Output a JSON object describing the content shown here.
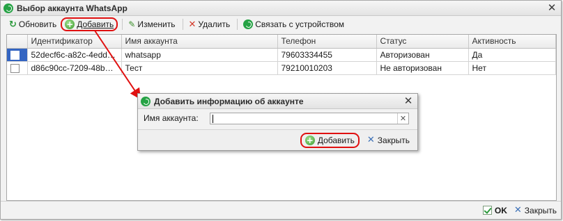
{
  "window": {
    "title": "Выбор аккаунта WhatsApp",
    "close_glyph": "✕"
  },
  "toolbar": {
    "refresh_label": "Обновить",
    "add_label": "Добавить",
    "edit_label": "Изменить",
    "delete_label": "Удалить",
    "connect_label": "Связать с устройством"
  },
  "table": {
    "columns": [
      "",
      "Идентификатор",
      "Имя аккаунта",
      "Телефон",
      "Статус",
      "Активность"
    ],
    "rows": [
      {
        "id": "52decf6c-a82c-4edd-b1...",
        "name": "whatsapp",
        "phone": "79603334455",
        "status": "Авторизован",
        "active": "Да",
        "selected": true
      },
      {
        "id": "d86c90cc-7209-48b1-9...",
        "name": "Тест",
        "phone": "79210010203",
        "status": "Не авторизован",
        "active": "Нет",
        "selected": false
      }
    ]
  },
  "footer": {
    "ok_label": "OK",
    "close_label": "Закрыть"
  },
  "dialog": {
    "title": "Добавить информацию об аккаунте",
    "field_label": "Имя аккаунта:",
    "field_value": "",
    "add_label": "Добавить",
    "close_label": "Закрыть"
  },
  "icons": {
    "window": "whatsapp-icon",
    "refresh": "refresh-icon",
    "add": "plus-circle-icon",
    "edit": "pencil-icon",
    "delete": "delete-x-icon",
    "connect": "whatsapp-icon",
    "ok": "checkmark-icon",
    "close": "close-x-icon"
  },
  "colors": {
    "annotation_red": "#e01010",
    "selection_blue": "#3465c2",
    "whatsapp_green": "#25a244"
  }
}
